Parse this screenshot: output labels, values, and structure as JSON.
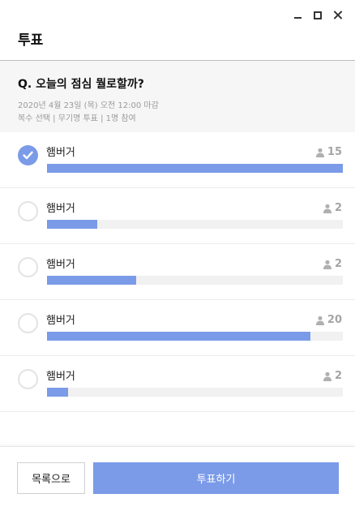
{
  "window": {
    "controls": [
      "minimize-icon",
      "maximize-icon",
      "close-icon"
    ]
  },
  "header": {
    "title": "투표"
  },
  "question": {
    "title": "Q. 오늘의 점심 뭘로할까?",
    "deadline": "2020년 4월 23일 (목) 오전 12:00 마감",
    "settings": "복수 선택 | 무기명 투표 | 1명 참여"
  },
  "options": [
    {
      "label": "햄버거",
      "count": "15",
      "selected": true,
      "fill": 1.0
    },
    {
      "label": "햄버거",
      "count": "2",
      "selected": false,
      "fill": 0.17
    },
    {
      "label": "햄버거",
      "count": "2",
      "selected": false,
      "fill": 0.3
    },
    {
      "label": "햄버거",
      "count": "20",
      "selected": false,
      "fill": 0.89
    },
    {
      "label": "햄버거",
      "count": "2",
      "selected": false,
      "fill": 0.07
    }
  ],
  "footer": {
    "list_label": "목록으로",
    "vote_label": "투표하기"
  },
  "colors": {
    "accent": "#7b9be8",
    "track": "#f1f1f1",
    "count_text": "#a5a5a5"
  }
}
